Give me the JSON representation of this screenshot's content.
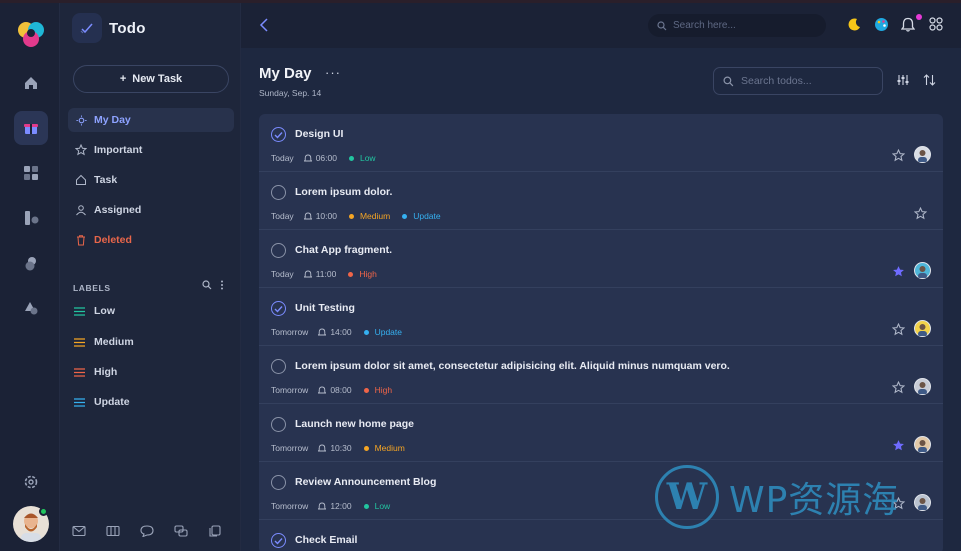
{
  "app": {
    "title": "Todo",
    "new_task_label": "New Task"
  },
  "sidebar": {
    "items": [
      {
        "label": "My Day",
        "icon": "sun-icon"
      },
      {
        "label": "Important",
        "icon": "star-icon"
      },
      {
        "label": "Task",
        "icon": "home-icon"
      },
      {
        "label": "Assigned",
        "icon": "user-icon"
      },
      {
        "label": "Deleted",
        "icon": "trash-icon"
      }
    ],
    "labels_heading": "LABELS",
    "labels": [
      {
        "label": "Low",
        "color": "#22c5a0"
      },
      {
        "label": "Medium",
        "color": "#f5a524"
      },
      {
        "label": "High",
        "color": "#f06548"
      },
      {
        "label": "Update",
        "color": "#35b0f0"
      }
    ]
  },
  "topbar": {
    "search_placeholder": "Search here..."
  },
  "main": {
    "title": "My Day",
    "more": "···",
    "date": "Sunday, Sep. 14",
    "search_placeholder": "Search todos..."
  },
  "tasks": [
    {
      "title": "Design UI",
      "done": true,
      "day": "Today",
      "time": "06:00",
      "tags": [
        {
          "label": "Low",
          "color": "#22c5a0"
        }
      ],
      "starred": false,
      "avatar_color": "#d9dde4"
    },
    {
      "title": "Lorem ipsum dolor.",
      "done": false,
      "day": "Today",
      "time": "10:00",
      "tags": [
        {
          "label": "Medium",
          "color": "#f5a524"
        },
        {
          "label": "Update",
          "color": "#35b0f0"
        }
      ],
      "starred": false,
      "avatar_color": null
    },
    {
      "title": "Chat App fragment.",
      "done": false,
      "day": "Today",
      "time": "11:00",
      "tags": [
        {
          "label": "High",
          "color": "#f06548"
        }
      ],
      "starred": true,
      "avatar_color": "#4fb6d8"
    },
    {
      "title": "Unit Testing",
      "done": true,
      "day": "Tomorrow",
      "time": "14:00",
      "tags": [
        {
          "label": "Update",
          "color": "#35b0f0"
        }
      ],
      "starred": false,
      "avatar_color": "#f2d24a"
    },
    {
      "title": "Lorem ipsum dolor sit amet, consectetur adipisicing elit. Aliquid minus numquam vero.",
      "done": false,
      "day": "Tomorrow",
      "time": "08:00",
      "tags": [
        {
          "label": "High",
          "color": "#f06548"
        }
      ],
      "starred": false,
      "avatar_color": "#c8ccd6"
    },
    {
      "title": "Launch new home page",
      "done": false,
      "day": "Tomorrow",
      "time": "10:30",
      "tags": [
        {
          "label": "Medium",
          "color": "#f5a524"
        }
      ],
      "starred": true,
      "avatar_color": "#e2c9a8"
    },
    {
      "title": "Review Announcement Blog",
      "done": false,
      "day": "Tomorrow",
      "time": "12:00",
      "tags": [
        {
          "label": "Low",
          "color": "#22c5a0"
        }
      ],
      "starred": false,
      "avatar_color": "#b9c2cf"
    },
    {
      "title": "Check Email",
      "done": true,
      "day": "",
      "time": "",
      "tags": [],
      "starred": false,
      "avatar_color": null
    }
  ],
  "watermark": {
    "logo": "W",
    "text": "WP资源海"
  },
  "colors": {
    "accent": "#7b8cff",
    "star_active": "#6f6bff",
    "deleted": "#e8664a"
  }
}
